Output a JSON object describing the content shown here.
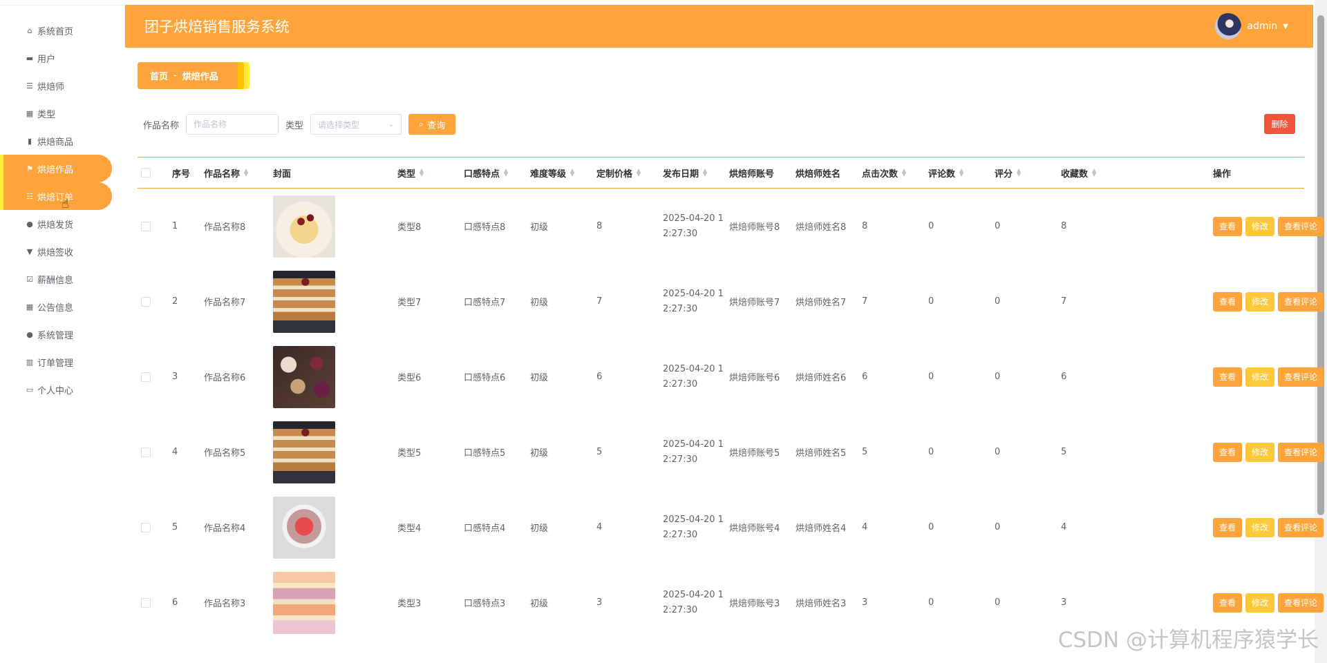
{
  "app": {
    "title": "团子烘焙销售服务系统"
  },
  "user": {
    "name": "admin"
  },
  "sidebar": {
    "items": [
      {
        "label": "系统首页",
        "icon": "home-icon"
      },
      {
        "label": "用户",
        "icon": "monitor-icon"
      },
      {
        "label": "烘焙师",
        "icon": "list-icon"
      },
      {
        "label": "类型",
        "icon": "grid-icon"
      },
      {
        "label": "烘焙商品",
        "icon": "clipboard-icon"
      },
      {
        "label": "烘焙作品",
        "icon": "flag-icon",
        "active": true
      },
      {
        "label": "烘焙订单",
        "icon": "sliders-icon",
        "active": true
      },
      {
        "label": "烘焙发货",
        "icon": "person-icon"
      },
      {
        "label": "烘焙签收",
        "icon": "stamp-icon"
      },
      {
        "label": "薪酬信息",
        "icon": "checklist-icon"
      },
      {
        "label": "公告信息",
        "icon": "grid-icon"
      },
      {
        "label": "系统管理",
        "icon": "person-icon"
      },
      {
        "label": "订单管理",
        "icon": "bars-icon"
      },
      {
        "label": "个人中心",
        "icon": "window-icon"
      }
    ]
  },
  "breadcrumb": {
    "home": "首页",
    "separator": "-",
    "current": "烘焙作品"
  },
  "search": {
    "name_label": "作品名称",
    "name_placeholder": "作品名称",
    "type_label": "类型",
    "type_placeholder": "请选择类型",
    "query_label": "查询"
  },
  "toolbar": {
    "delete_label": "删除"
  },
  "table": {
    "columns": [
      "序号",
      "作品名称",
      "封面",
      "类型",
      "口感特点",
      "难度等级",
      "定制价格",
      "发布日期",
      "烘焙师账号",
      "烘焙师姓名",
      "点击次数",
      "评论数",
      "评分",
      "收藏数",
      "操作"
    ],
    "actions": {
      "view": "查看",
      "edit": "修改",
      "reviews": "查看评论",
      "delete": "删除"
    },
    "rows": [
      {
        "no": "1",
        "name": "作品名称8",
        "type": "类型8",
        "taste": "口感特点8",
        "level": "初级",
        "price": "8",
        "date": "2025-04-20 12:27:30",
        "account": "烘焙师账号8",
        "baker": "烘焙师姓名8",
        "clicks": "8",
        "comments": "0",
        "score": "0",
        "favs": "8",
        "cover": "cake-slice"
      },
      {
        "no": "2",
        "name": "作品名称7",
        "type": "类型7",
        "taste": "口感特点7",
        "level": "初级",
        "price": "7",
        "date": "2025-04-20 12:27:30",
        "account": "烘焙师账号7",
        "baker": "烘焙师姓名7",
        "clicks": "7",
        "comments": "0",
        "score": "0",
        "favs": "7",
        "cover": "pancake-stack"
      },
      {
        "no": "3",
        "name": "作品名称6",
        "type": "类型6",
        "taste": "口感特点6",
        "level": "初级",
        "price": "6",
        "date": "2025-04-20 12:27:30",
        "account": "烘焙师账号6",
        "baker": "烘焙师姓名6",
        "clicks": "6",
        "comments": "0",
        "score": "0",
        "favs": "6",
        "cover": "cupcakes"
      },
      {
        "no": "4",
        "name": "作品名称5",
        "type": "类型5",
        "taste": "口感特点5",
        "level": "初级",
        "price": "5",
        "date": "2025-04-20 12:27:30",
        "account": "烘焙师账号5",
        "baker": "烘焙师姓名5",
        "clicks": "5",
        "comments": "0",
        "score": "0",
        "favs": "5",
        "cover": "pancake-stack"
      },
      {
        "no": "5",
        "name": "作品名称4",
        "type": "类型4",
        "taste": "口感特点4",
        "level": "初级",
        "price": "4",
        "date": "2025-04-20 12:27:30",
        "account": "烘焙师账号4",
        "baker": "烘焙师姓名4",
        "clicks": "4",
        "comments": "0",
        "score": "0",
        "favs": "4",
        "cover": "berry-bowl"
      },
      {
        "no": "6",
        "name": "作品名称3",
        "type": "类型3",
        "taste": "口感特点3",
        "level": "初级",
        "price": "3",
        "date": "2025-04-20 12:27:30",
        "account": "烘焙师账号3",
        "baker": "烘焙师姓名3",
        "clicks": "3",
        "comments": "0",
        "score": "0",
        "favs": "3",
        "cover": "macarons"
      }
    ]
  },
  "colors": {
    "accent": "#ffa43a",
    "warning": "#ffc93a",
    "danger": "#f0553b",
    "crumb_mid": "#ffc107",
    "crumb_back": "#ffeb3b"
  },
  "watermark": "CSDN @计算机程序猿学长"
}
